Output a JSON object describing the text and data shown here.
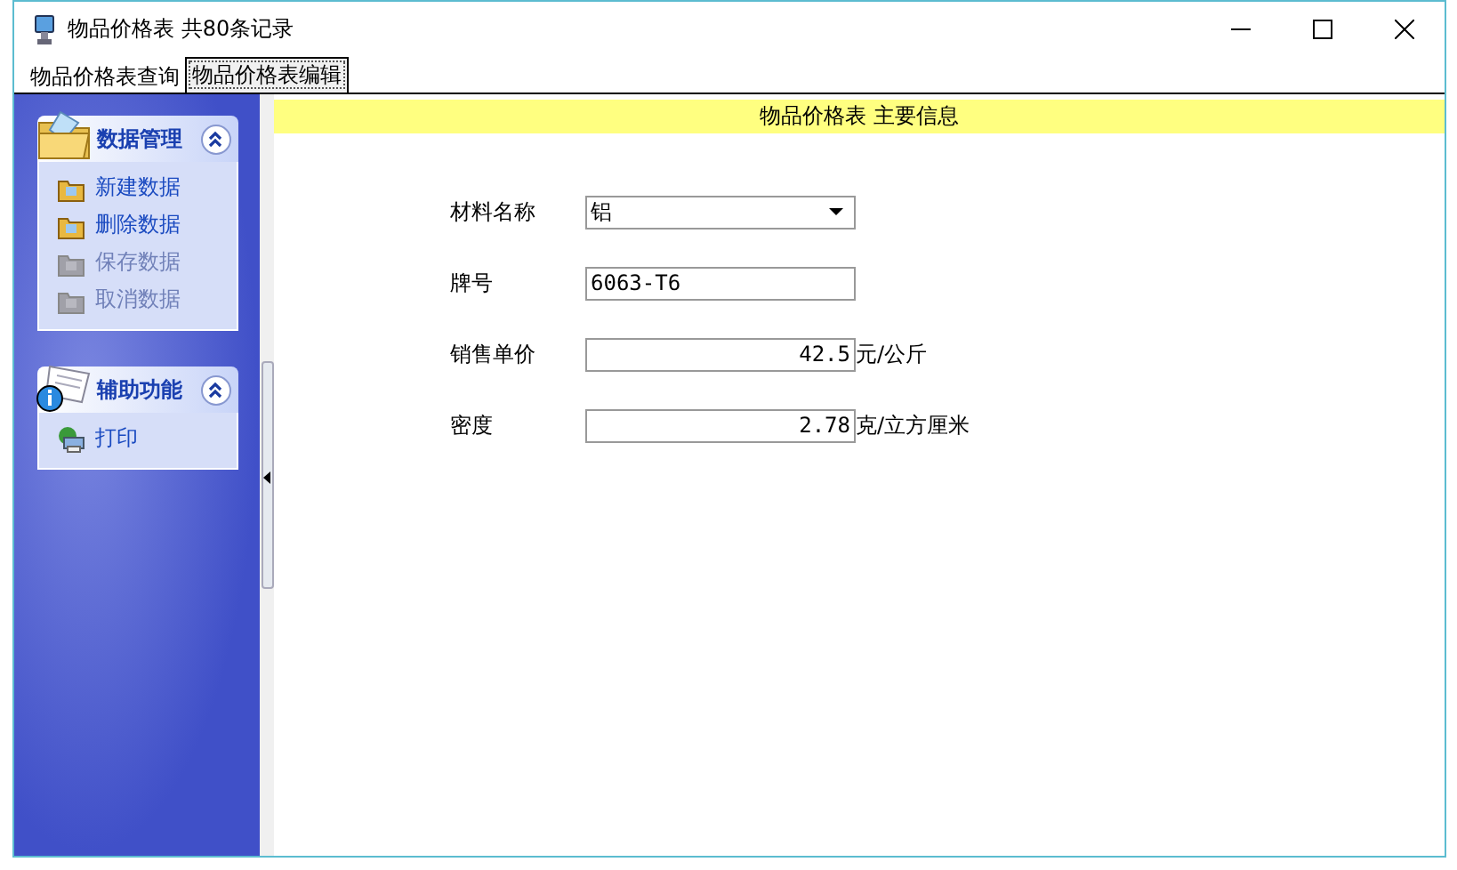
{
  "window": {
    "title": "物品价格表 共80条记录"
  },
  "tabs": [
    {
      "label": "物品价格表查询",
      "selected": false
    },
    {
      "label": "物品价格表编辑",
      "selected": true
    }
  ],
  "sidebar": {
    "groups": [
      {
        "title": "数据管理",
        "expanded": true,
        "items": [
          {
            "label": "新建数据",
            "disabled": false
          },
          {
            "label": "删除数据",
            "disabled": false
          },
          {
            "label": "保存数据",
            "disabled": true
          },
          {
            "label": "取消数据",
            "disabled": true
          }
        ]
      },
      {
        "title": "辅助功能",
        "expanded": true,
        "items": [
          {
            "label": "打印",
            "disabled": false
          }
        ]
      }
    ]
  },
  "form": {
    "header": "物品价格表 主要信息",
    "fields": [
      {
        "label": "材料名称",
        "kind": "select",
        "value": "铝"
      },
      {
        "label": "牌号",
        "kind": "text",
        "value": "6063-T6"
      },
      {
        "label": "销售单价",
        "kind": "number",
        "value": "42.5",
        "unit": "元/公斤"
      },
      {
        "label": "密度",
        "kind": "number",
        "value": "2.78",
        "unit": "克/立方厘米"
      }
    ]
  }
}
